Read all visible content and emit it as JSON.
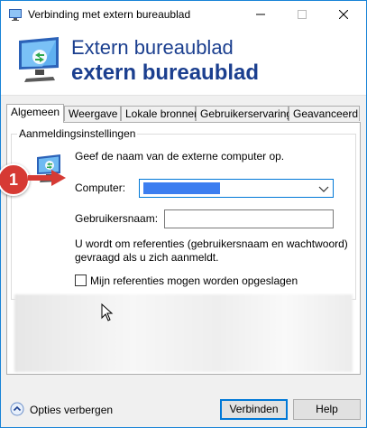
{
  "window": {
    "title": "Verbinding met extern bureaublad"
  },
  "titlebar_buttons": {
    "minimize": "—",
    "maximize": "☐",
    "close": "✕"
  },
  "header": {
    "line1": "Extern bureaublad",
    "line2": "extern bureaublad"
  },
  "tabs": [
    {
      "label": "Algemeen",
      "active": true
    },
    {
      "label": "Weergave"
    },
    {
      "label": "Lokale bronnen"
    },
    {
      "label": "Gebruikerservaring"
    },
    {
      "label": "Geavanceerd"
    }
  ],
  "login_group": {
    "legend": "Aanmeldingsinstellingen",
    "instruction": "Geef de naam van de externe computer op.",
    "computer_label": "Computer:",
    "computer_value": "",
    "username_label": "Gebruikersnaam:",
    "username_value": "",
    "note_line1": "U wordt om referenties (gebruikersnaam en wachtwoord)",
    "note_line2": "gevraagd als u zich aanmeldt.",
    "save_credentials_label": "Mijn referenties mogen worden opgeslagen",
    "save_credentials_checked": false
  },
  "annotation": {
    "step_number": "1"
  },
  "footer": {
    "options_label": "Opties verbergen",
    "connect_label": "Verbinden",
    "help_label": "Help"
  }
}
